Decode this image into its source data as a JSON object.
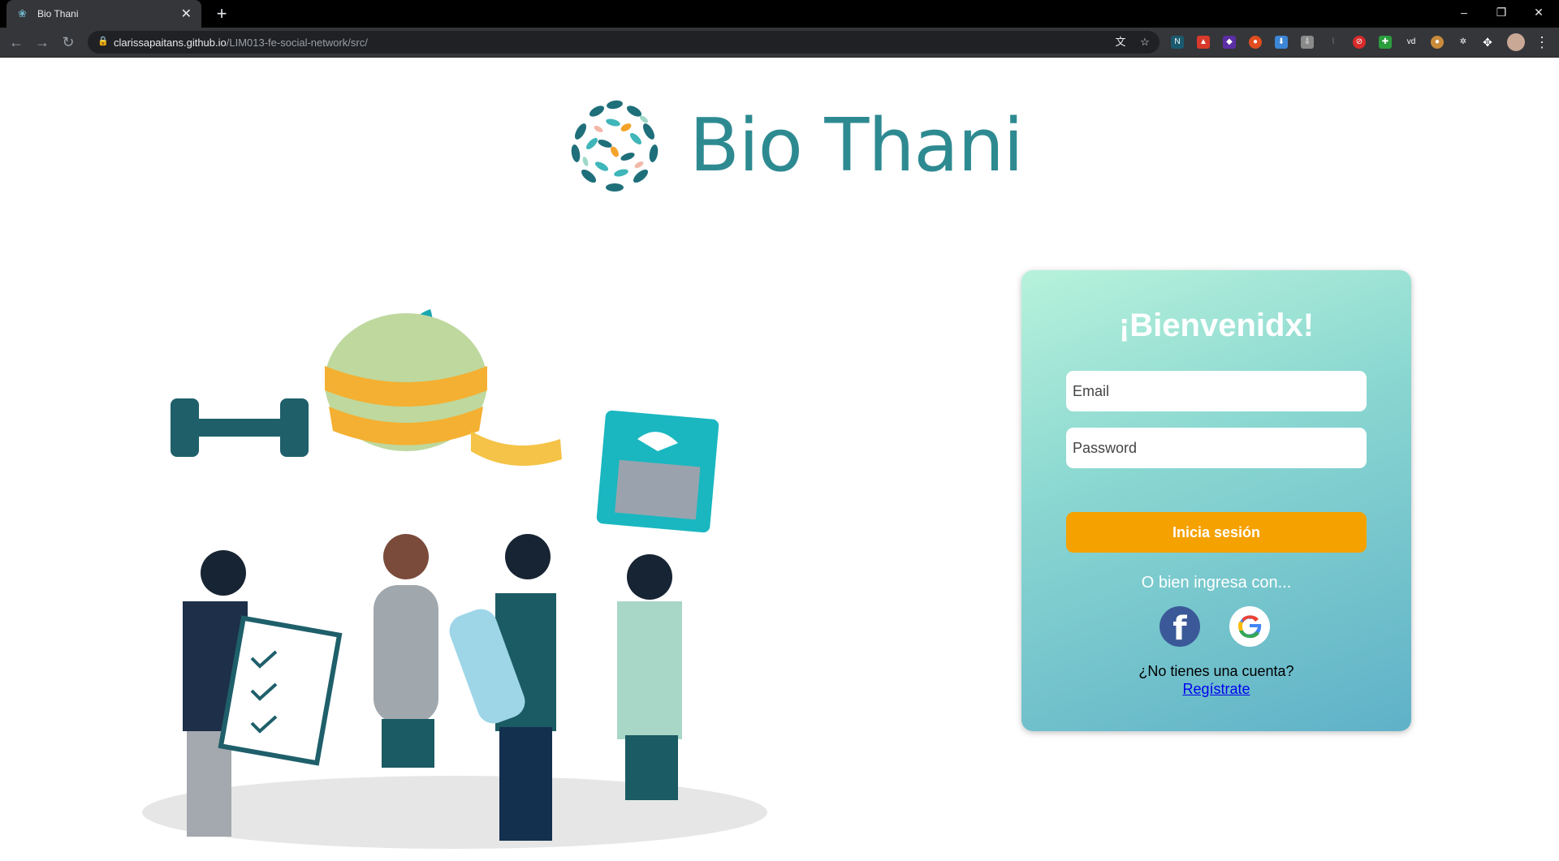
{
  "browser": {
    "tab_title": "Bio Thani",
    "url_host": "clarissapaitans.github.io",
    "url_path": "/LIM013-fe-social-network/src/",
    "extensions": [
      "translate-icon",
      "star-icon",
      "ext-n",
      "ext-red",
      "ext-purple",
      "ext-orange",
      "ext-blue",
      "ext-download",
      "ext-gray",
      "ext-red-circle",
      "ext-green",
      "ext-vd",
      "ext-cookie",
      "ext-gear",
      "puzzle-icon"
    ]
  },
  "logo": {
    "text": "Bio Thani"
  },
  "login": {
    "heading": "¡Bienvenidx!",
    "email_placeholder": "Email",
    "password_placeholder": "Password",
    "submit_label": "Inicia sesión",
    "or_text": "O bien ingresa con...",
    "facebook_letter": "f",
    "no_account_text": "¿No tienes una cuenta?",
    "register_link": "Regístrate"
  },
  "colors": {
    "brand": "#2e8a91",
    "button": "#f5a100",
    "card_gradient_start": "#b7f2db",
    "card_gradient_end": "#5fb1c8"
  }
}
